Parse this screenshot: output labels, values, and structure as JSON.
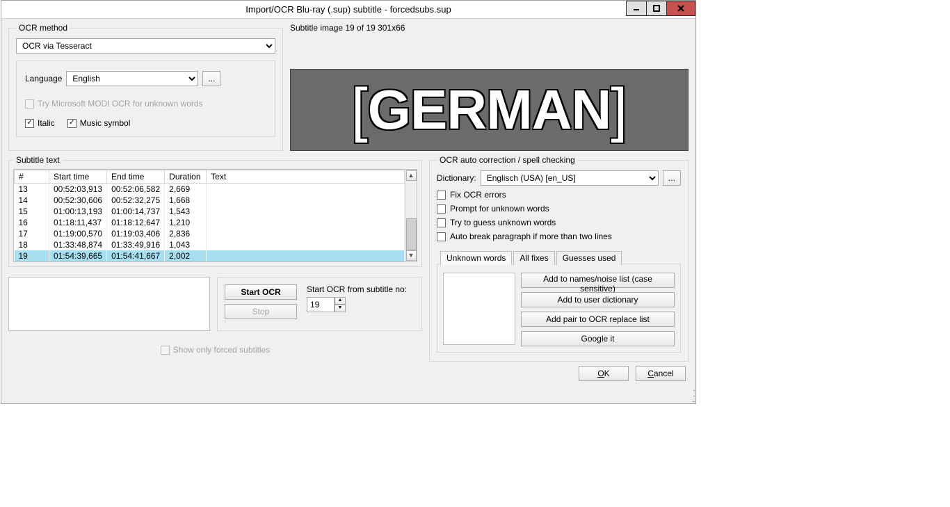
{
  "window": {
    "title": "Import/OCR Blu-ray (.sup) subtitle - forcedsubs.sup"
  },
  "ocr_method": {
    "legend": "OCR method",
    "combo_value": "OCR via Tesseract",
    "language_label": "Language",
    "language_value": "English",
    "modi_label": "Try Microsoft MODI OCR for unknown words",
    "italic_label": "Italic",
    "music_label": "Music symbol"
  },
  "preview": {
    "label": "Subtitle image 19 of 19   301x66",
    "text": "GERMAN"
  },
  "subtable": {
    "legend": "Subtitle text",
    "cols": {
      "num": "#",
      "start": "Start time",
      "end": "End time",
      "dur": "Duration",
      "text": "Text"
    },
    "rows": [
      {
        "n": "13",
        "s": "00:52:03,913",
        "e": "00:52:06,582",
        "d": "2,669",
        "t": ""
      },
      {
        "n": "14",
        "s": "00:52:30,606",
        "e": "00:52:32,275",
        "d": "1,668",
        "t": ""
      },
      {
        "n": "15",
        "s": "01:00:13,193",
        "e": "01:00:14,737",
        "d": "1,543",
        "t": ""
      },
      {
        "n": "16",
        "s": "01:18:11,437",
        "e": "01:18:12,647",
        "d": "1,210",
        "t": ""
      },
      {
        "n": "17",
        "s": "01:19:00,570",
        "e": "01:19:03,406",
        "d": "2,836",
        "t": ""
      },
      {
        "n": "18",
        "s": "01:33:48,874",
        "e": "01:33:49,916",
        "d": "1,043",
        "t": ""
      },
      {
        "n": "19",
        "s": "01:54:39,665",
        "e": "01:54:41,667",
        "d": "2,002",
        "t": ""
      }
    ]
  },
  "ocr_control": {
    "start_label": "Start OCR",
    "stop_label": "Stop",
    "from_label": "Start OCR from subtitle no:",
    "from_value": "19"
  },
  "forced": {
    "label": "Show only forced subtitles"
  },
  "autocorrect": {
    "legend": "OCR auto correction / spell checking",
    "dict_label": "Dictionary:",
    "dict_value": "Englisch (USA) [en_US]",
    "fix_label": "Fix OCR errors",
    "prompt_label": "Prompt for unknown words",
    "guess_label": "Try to guess unknown words",
    "break_label": "Auto break paragraph if more than two lines",
    "tabs": {
      "unknown": "Unknown words",
      "fixes": "All fixes",
      "guesses": "Guesses used"
    },
    "btns": {
      "add_names": "Add to names/noise list (case sensitive)",
      "add_dict": "Add to user dictionary",
      "add_pair": "Add pair to OCR replace list",
      "google": "Google it"
    }
  },
  "footer": {
    "ok": "OK",
    "cancel": "Cancel"
  }
}
